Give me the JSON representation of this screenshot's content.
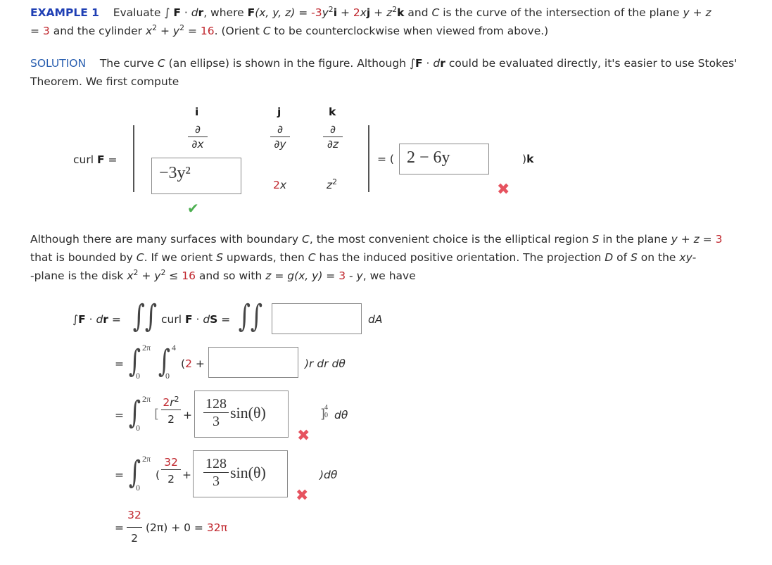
{
  "example": {
    "label": "EXAMPLE 1",
    "line1_pre": "Evaluate ∫ ",
    "F": "F",
    "dot": " · ",
    "d": "d",
    "r": "r",
    "where": ", where ",
    "Fxyz": "(x, y, z)",
    "eq": " = ",
    "coef1": "-3",
    "y": "y",
    "sq": "2",
    "i": "i",
    "plus": " + ",
    "coef2": "2",
    "x": "x",
    "j": "j",
    "z": "z",
    "k": "k",
    "rest1": " and ",
    "C": "C",
    "rest2": " is the curve of the intersection of the plane ",
    "yz": "y + z",
    "line2_eq": "= ",
    "three": "3",
    "rest3": " and the cylinder ",
    "cyl_eq": " = ",
    "sixteen": "16",
    "rest4": ". (Orient ",
    "rest5": " to be counterclockwise when viewed from above.)"
  },
  "solution": {
    "label": "SOLUTION",
    "t1": "The curve ",
    "C": "C",
    "t2": " (an ellipse) is shown in the figure. Although ∫",
    "F": "F",
    "dot": " · ",
    "d": "d",
    "r": "r",
    "t3": " could be evaluated directly, it's easier to use Stokes' Theorem. We first compute"
  },
  "curl": {
    "label_pre": "curl ",
    "label_F": "F",
    "label_eq": " =",
    "headers": [
      "i",
      "j",
      "k"
    ],
    "partials": [
      {
        "num": "∂",
        "den": "∂x"
      },
      {
        "num": "∂",
        "den": "∂y"
      },
      {
        "num": "∂",
        "den": "∂z"
      }
    ],
    "row3_input_value": "−3y²",
    "row3_input_status": "correct",
    "row3_j_coef": "2",
    "row3_j_var": "x",
    "row3_k": "z",
    "row3_k_exp": "2",
    "result_pre": "= (",
    "result_input_value": "2 − 6y",
    "result_input_status": "incorrect",
    "result_post": ")",
    "result_k": "k"
  },
  "para2": {
    "t1": "Although there are many surfaces with boundary ",
    "C": "C",
    "t2": ", the most convenient choice is the elliptical region ",
    "S": "S",
    "t3": " in the plane ",
    "yz": "y + z",
    "eq": " = ",
    "three": "3",
    "t4": " that is bounded by ",
    "t5": ". If we orient ",
    "t6": " upwards, then ",
    "t7": " has the induced positive orientation. The projection ",
    "D": "D",
    "t8": " of ",
    "t9": " on the ",
    "xy": "xy",
    "t10": "-plane is the disk ",
    "x": "x",
    "y": "y",
    "two": "2",
    "plus": " + ",
    "le": " ≤ ",
    "sixteen": "16",
    "t11": " and so with ",
    "z": "z",
    "g": "g",
    "gargs": "(x, y)",
    "t12": " = ",
    "t13": " - ",
    "t14": ", we have"
  },
  "steps": {
    "line1": {
      "lhs_int": "∫",
      "F": "F",
      "dot": " · ",
      "d": "d",
      "r": "r",
      "eq": " =",
      "curl": "curl ",
      "dS_d": "d",
      "dS_S": "S",
      "eq2": " =",
      "input_value": "",
      "suffix": "dA"
    },
    "line2": {
      "eq": "=",
      "outer_upper": "2π",
      "outer_lower": "0",
      "inner_upper": "4",
      "inner_lower": "0",
      "open": "(",
      "two": "2",
      "plus": " +",
      "input_value": "",
      "suffix": ")r dr dθ"
    },
    "line3": {
      "eq": "=",
      "upper": "2π",
      "lower": "0",
      "bracket": "[",
      "num_coef": "2",
      "num_var": "r",
      "num_exp": "2",
      "den": "2",
      "plus": "+",
      "input_num": "128",
      "input_den": "3",
      "input_fn": "sin(θ)",
      "input_status": "incorrect",
      "eval_bracket": "]",
      "eval_upper": "4",
      "eval_lower": "0",
      "suffix": "dθ"
    },
    "line4": {
      "eq": "=",
      "upper": "2π",
      "lower": "0",
      "open": "(",
      "num": "32",
      "den": "2",
      "plus": "+",
      "input_num": "128",
      "input_den": "3",
      "input_fn": "sin(θ)",
      "input_status": "incorrect",
      "suffix": ")dθ"
    },
    "line5": {
      "eq": "=",
      "num": "32",
      "den": "2",
      "mid": "(2π) + 0 = ",
      "result": "32π"
    }
  },
  "colors": {
    "example_label": "#1f3fb4",
    "solution_label": "#2a5fb0",
    "highlight_number": "#c0262d",
    "incorrect_mark": "#e6535f",
    "correct_mark": "#4caf50"
  }
}
